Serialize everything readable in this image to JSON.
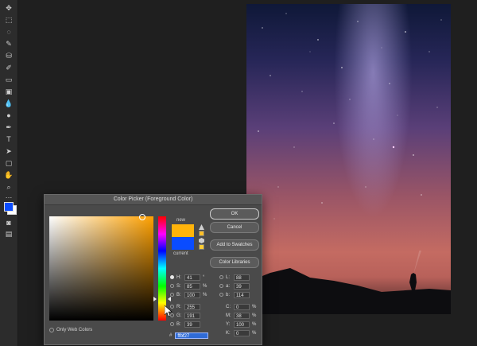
{
  "dialog": {
    "title": "Color Picker (Foreground Color)",
    "labels": {
      "new": "new",
      "current": "current"
    },
    "buttons": {
      "ok": "OK",
      "cancel": "Cancel",
      "add_to_swatches": "Add to Swatches",
      "color_libraries": "Color Libraries"
    },
    "only_web_colors": "Only Web Colors",
    "hsb": [
      {
        "label": "H:",
        "value": "41",
        "unit": "°"
      },
      {
        "label": "S:",
        "value": "85",
        "unit": "%"
      },
      {
        "label": "B:",
        "value": "100",
        "unit": "%"
      }
    ],
    "rgb": [
      {
        "label": "R:",
        "value": "255"
      },
      {
        "label": "G:",
        "value": "191"
      },
      {
        "label": "B:",
        "value": "39"
      }
    ],
    "lab": [
      {
        "label": "L:",
        "value": "88"
      },
      {
        "label": "a:",
        "value": "39"
      },
      {
        "label": "b:",
        "value": "114"
      }
    ],
    "cmyk": [
      {
        "label": "C:",
        "value": "0",
        "unit": "%"
      },
      {
        "label": "M:",
        "value": "38",
        "unit": "%"
      },
      {
        "label": "Y:",
        "value": "100",
        "unit": "%"
      },
      {
        "label": "K:",
        "value": "0",
        "unit": "%"
      }
    ],
    "hex": {
      "prefix": "#",
      "value": "ffbf27"
    },
    "colors": {
      "new": "#ffb40b",
      "current": "#0a4cff"
    }
  },
  "toolbar": {
    "foreground_color": "#0a4cff",
    "background_color": "#ffffff"
  }
}
